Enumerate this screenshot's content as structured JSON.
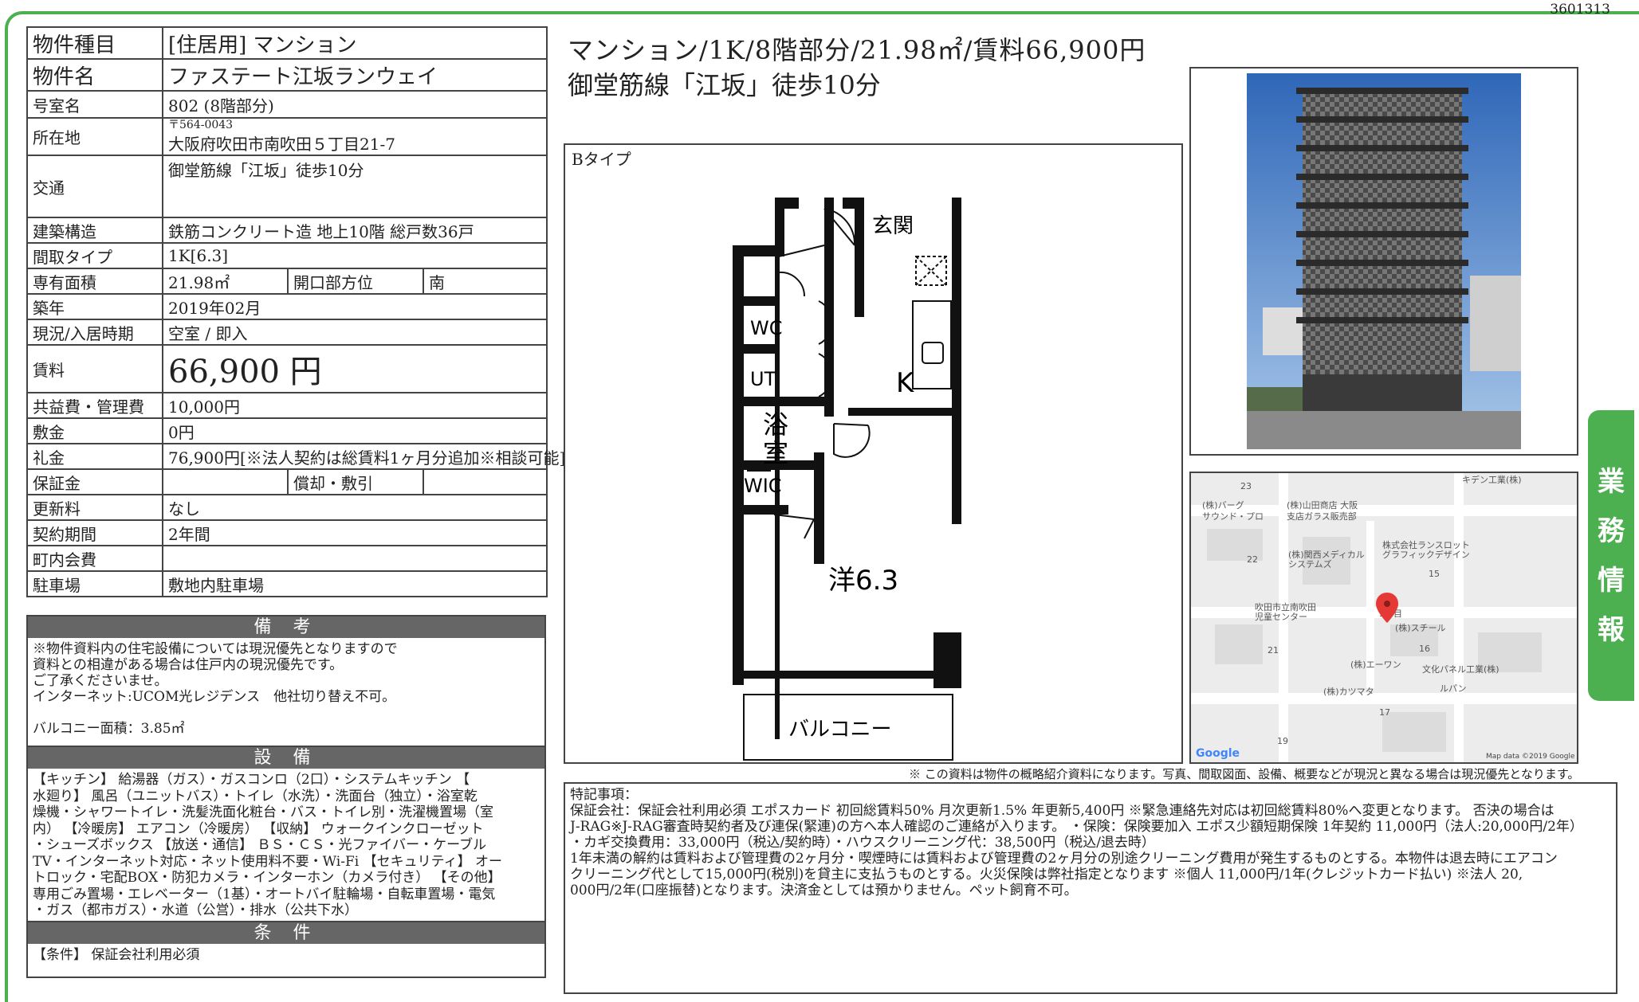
{
  "doc_id": "3601313",
  "side_tab": [
    "業",
    "務",
    "情",
    "報"
  ],
  "spec": {
    "type_label": "物件種目",
    "type_value": "[住居用] マンション",
    "name_label": "物件名",
    "name_value": "ファステート江坂ランウェイ",
    "room_label": "号室名",
    "room_value": "802 (8階部分)",
    "addr_label": "所在地",
    "addr_zip": "〒564-0043",
    "addr_value": "大阪府吹田市南吹田５丁目21-7",
    "traffic_label": "交通",
    "traffic_value": "御堂筋線「江坂」徒歩10分",
    "structure_label": "建築構造",
    "structure_value": "鉄筋コンクリート造 地上10階 総戸数36戸",
    "layout_label": "間取タイプ",
    "layout_value": "1K[6.3]",
    "area_label": "専有面積",
    "area_value": "21.98㎡",
    "direction_label": "開口部方位",
    "direction_value": "南",
    "built_label": "築年",
    "built_value": "2019年02月",
    "status_label": "現況/入居時期",
    "status_value": "空室 / 即入",
    "rent_label": "賃料",
    "rent_value": "66,900 円",
    "fee_label": "共益費・管理費",
    "fee_value": "10,000円",
    "deposit_label": "敷金",
    "deposit_value": "0円",
    "key_label": "礼金",
    "key_value": "76,900円[※法人契約は総賃料1ヶ月分追加※相談可能]",
    "guarantee_label": "保証金",
    "guarantee_value": "",
    "amort_label": "償却・敷引",
    "amort_value": "",
    "renewal_label": "更新料",
    "renewal_value": "なし",
    "contract_label": "契約期間",
    "contract_value": "2年間",
    "town_label": "町内会費",
    "town_value": "",
    "parking_label": "駐車場",
    "parking_value": "敷地内駐車場"
  },
  "remarks": {
    "title": "備 考",
    "text": "※物件資料内の住宅設備については現況優先となりますので\n資料との相違がある場合は住戸内の現況優先です。\nご了承くださいませ。\nインターネット:UCOM光レジデンス　他社切り替え不可。\n\nバルコニー面積：3.85㎡"
  },
  "equipment": {
    "title": "設 備",
    "text": "【キッチン】 給湯器（ガス）・ガスコンロ（2口）・システムキッチン 【\n水廻り】 風呂（ユニットバス）・トイレ（水洗）・洗面台（独立）・浴室乾\n燥機・シャワートイレ・洗髪洗面化粧台・バス・トイレ別・洗濯機置場（室\n内） 【冷暖房】 エアコン（冷暖房） 【収納】 ウォークインクローゼット\n・シューズボックス 【放送・通信】 ＢＳ・ＣＳ・光ファイバー・ケーブル\nTV・インターネット対応・ネット使用料不要・Wi-Fi 【セキュリティ】 オー\nトロック・宅配BOX・防犯カメラ・インターホン（カメラ付き） 【その他】\n専用ごみ置場・エレベーター（1基）・オートバイ駐輪場・自転車置場・電気\n・ガス（都市ガス）・水道（公営）・排水（公共下水）"
  },
  "conditions": {
    "title": "条 件",
    "text": "【条件】 保証会社利用必須"
  },
  "headline": {
    "line1": "マンション/1K/8階部分/21.98㎡/賃料66,900円",
    "line2": "御堂筋線「江坂」徒歩10分"
  },
  "floorplan": {
    "label": "Bタイプ",
    "rooms": {
      "genkan": "玄関",
      "wc": "WC",
      "ut": "UT",
      "bath1": "浴",
      "bath2": "室",
      "k": "K",
      "wic": "WIC",
      "western": "洋6.3",
      "balcony": "バルコニー"
    }
  },
  "map": {
    "labels": [
      "23",
      "キデン工業(株)",
      "(株)バーグ",
      "サウンド・プロ",
      "(株)山田商店 大阪",
      "支店ガラス販売部",
      "22",
      "(株)関西メディカル",
      "システムズ",
      "株式会社ランスロット",
      "グラフィックデザイン",
      "15",
      "吹田市立南吹田",
      "児童センター",
      "5丁目",
      "(株)スチール",
      "21",
      "16",
      "(株)エーワン",
      "文化パネル工業(株)",
      "(株)カツマタ",
      "ルパン",
      "17",
      "19"
    ],
    "google": "Google",
    "copyright": "Map data ©2019 Google"
  },
  "notice": "※ この資料は物件の概略紹介資料になります。写真、間取図面、設備、概要などが現況と異なる場合は現況優先となります。",
  "notes": "特記事項：\n保証会社：保証会社利用必須 エポスカード 初回総賃料50% 月次更新1.5% 年更新5,400円 ※緊急連絡先対応は初回総賃料80%へ変更となります。 否決の場合は\nJ-RAG※J-RAG審査時契約者及び連保(緊連)の方へ本人確認のご連絡が入ります。 ・保険：保険要加入 エポス少額短期保険 1年契約 11,000円（法人:20,000円/2年）\n・カギ交換費用：33,000円（税込/契約時）・ハウスクリーニング代：38,500円（税込/退去時）\n1年未満の解約は賃料および管理費の2ヶ月分・喫煙時には賃料および管理費の2ヶ月分の別途クリーニング費用が発生するものとする。本物件は退去時にエアコン\nクリーニング代として15,000円(税別)を貸主に支払うものとする。火災保険は弊社指定となります ※個人 11,000円/1年(クレジットカード払い) ※法人 20,\n000円/2年(口座振替)となります。決済金としては預かりません。ペット飼育不可。"
}
